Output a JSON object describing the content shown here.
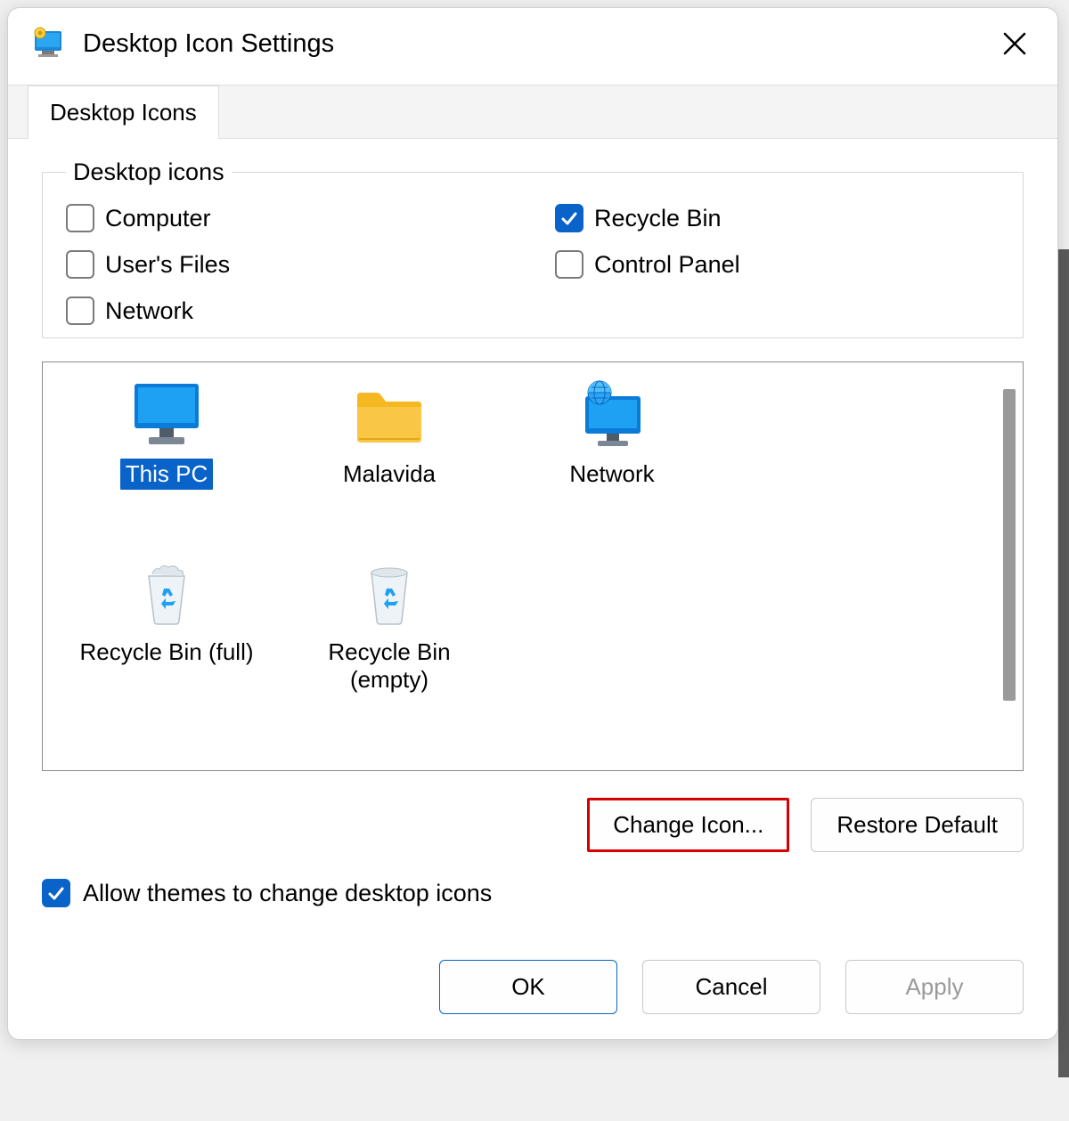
{
  "window": {
    "title": "Desktop Icon Settings"
  },
  "tabs": {
    "active": "Desktop Icons"
  },
  "group": {
    "legend": "Desktop icons",
    "checks": {
      "computer": {
        "label": "Computer",
        "checked": false
      },
      "recyclebin": {
        "label": "Recycle Bin",
        "checked": true
      },
      "usersfiles": {
        "label": "User's Files",
        "checked": false
      },
      "controlpanel": {
        "label": "Control Panel",
        "checked": false
      },
      "network": {
        "label": "Network",
        "checked": false
      }
    }
  },
  "preview": {
    "items": [
      {
        "id": "thispc",
        "label": "This PC",
        "selected": true
      },
      {
        "id": "malavida",
        "label": "Malavida",
        "selected": false
      },
      {
        "id": "network",
        "label": "Network",
        "selected": false
      },
      {
        "id": "recyclefull",
        "label": "Recycle Bin (full)",
        "selected": false
      },
      {
        "id": "recycleempty",
        "label": "Recycle Bin (empty)",
        "selected": false
      }
    ]
  },
  "buttons": {
    "changeIcon": "Change Icon...",
    "restoreDefault": "Restore Default",
    "ok": "OK",
    "cancel": "Cancel",
    "apply": "Apply"
  },
  "allowThemes": {
    "label": "Allow themes to change desktop icons",
    "checked": true
  }
}
